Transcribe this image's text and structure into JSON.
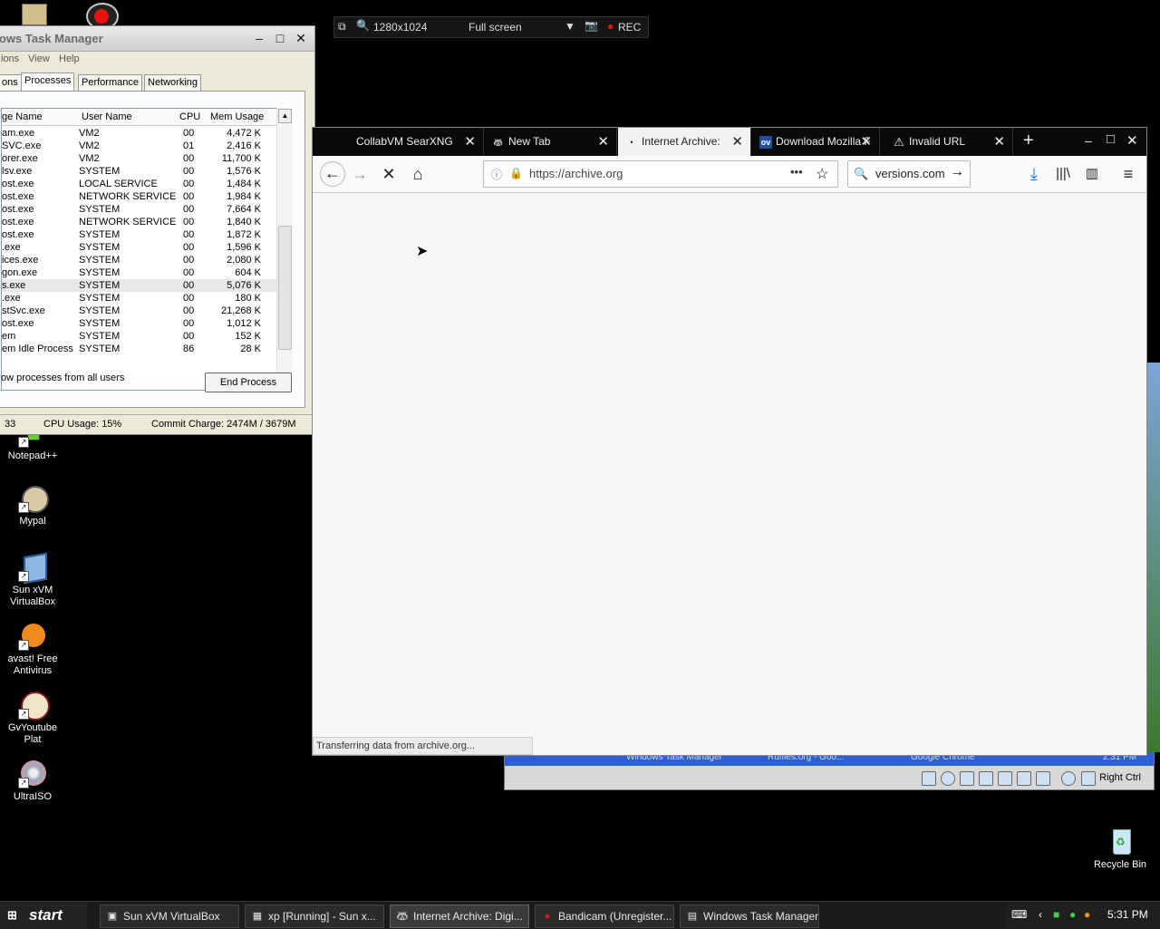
{
  "desktop_icons": [
    {
      "label": "Notepad++"
    },
    {
      "label": "Mypal"
    },
    {
      "label": "Sun xVM VirtualBox"
    },
    {
      "label": "avast! Free Antivirus"
    },
    {
      "label": "GvYoutube Plat"
    },
    {
      "label": "UltraISO"
    },
    {
      "label": "Recycle Bin"
    }
  ],
  "task_manager": {
    "title": "ows Task Manager",
    "menu": [
      "ions",
      "View",
      "Help"
    ],
    "tabs": [
      "ons",
      "Processes",
      "Performance",
      "Networking"
    ],
    "active_tab": "Processes",
    "columns": [
      "ge Name",
      "User Name",
      "CPU",
      "Mem Usage"
    ],
    "rows": [
      {
        "name": "am.exe",
        "user": "VM2",
        "cpu": "00",
        "mem": "4,472 K"
      },
      {
        "name": "SVC.exe",
        "user": "VM2",
        "cpu": "01",
        "mem": "2,416 K"
      },
      {
        "name": "orer.exe",
        "user": "VM2",
        "cpu": "00",
        "mem": "11,700 K"
      },
      {
        "name": "lsv.exe",
        "user": "SYSTEM",
        "cpu": "00",
        "mem": "1,576 K"
      },
      {
        "name": "ost.exe",
        "user": "LOCAL SERVICE",
        "cpu": "00",
        "mem": "1,484 K"
      },
      {
        "name": "ost.exe",
        "user": "NETWORK SERVICE",
        "cpu": "00",
        "mem": "1,984 K"
      },
      {
        "name": "ost.exe",
        "user": "SYSTEM",
        "cpu": "00",
        "mem": "7,664 K"
      },
      {
        "name": "ost.exe",
        "user": "NETWORK SERVICE",
        "cpu": "00",
        "mem": "1,840 K"
      },
      {
        "name": "ost.exe",
        "user": "SYSTEM",
        "cpu": "00",
        "mem": "1,872 K"
      },
      {
        "name": ".exe",
        "user": "SYSTEM",
        "cpu": "00",
        "mem": "1,596 K"
      },
      {
        "name": "ices.exe",
        "user": "SYSTEM",
        "cpu": "00",
        "mem": "2,080 K"
      },
      {
        "name": "gon.exe",
        "user": "SYSTEM",
        "cpu": "00",
        "mem": "604 K"
      },
      {
        "name": "s.exe",
        "user": "SYSTEM",
        "cpu": "00",
        "mem": "5,076 K"
      },
      {
        "name": ".exe",
        "user": "SYSTEM",
        "cpu": "00",
        "mem": "180 K"
      },
      {
        "name": "stSvc.exe",
        "user": "SYSTEM",
        "cpu": "00",
        "mem": "21,268 K"
      },
      {
        "name": "ost.exe",
        "user": "SYSTEM",
        "cpu": "00",
        "mem": "1,012 K"
      },
      {
        "name": "em",
        "user": "SYSTEM",
        "cpu": "00",
        "mem": "152 K"
      },
      {
        "name": "em Idle Process",
        "user": "SYSTEM",
        "cpu": "86",
        "mem": "28 K"
      }
    ],
    "selected_row": 12,
    "show_all_label": "ow processes from all users",
    "end_process": "End Process",
    "status": {
      "processes": "33",
      "cpu": "CPU Usage: 15%",
      "commit": "Commit Charge: 2474M / 3679M"
    }
  },
  "bandicam_bar": {
    "resolution": "1280x1024",
    "mode": "Full screen",
    "rec": "REC"
  },
  "firefox": {
    "tabs": [
      {
        "label": "CollabVM SearXNG",
        "favicon": ""
      },
      {
        "label": "New Tab",
        "favicon": "raccoon-icon"
      },
      {
        "label": "Internet Archive:",
        "favicon": "dot-icon"
      },
      {
        "label": "Download Mozilla F",
        "favicon": "ov"
      },
      {
        "label": "Invalid URL",
        "favicon": "warning-icon"
      }
    ],
    "active_tab": 2,
    "url": "https://archive.org",
    "search": "versions.com",
    "status": "Transferring data from archive.org..."
  },
  "vm_frame": {
    "strip_items": [
      "Windows Task Manager",
      "Ruffles.org - Goo...",
      "Google Chrome",
      "2:31 PM"
    ],
    "host_key": "Right Ctrl"
  },
  "taskbar": {
    "start": "start",
    "buttons": [
      {
        "label": "Sun xVM VirtualBox"
      },
      {
        "label": "xp [Running] - Sun x..."
      },
      {
        "label": "Internet Archive: Digi..."
      },
      {
        "label": "Bandicam (Unregister..."
      },
      {
        "label": "Windows Task Manager"
      }
    ],
    "active_button": 2,
    "clock": "5:31 PM"
  }
}
